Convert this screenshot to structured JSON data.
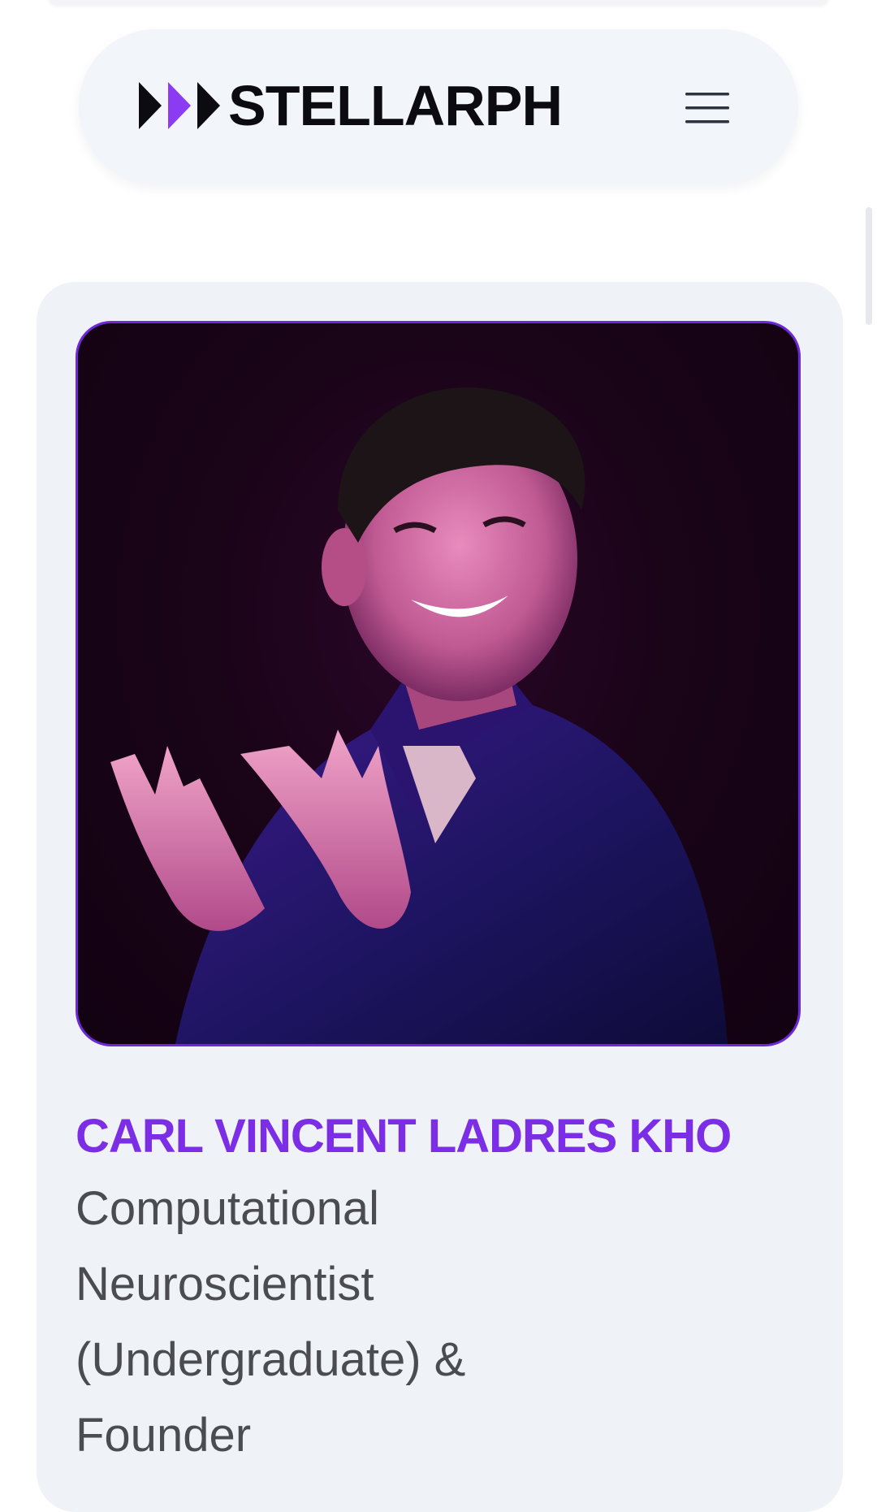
{
  "header": {
    "brand": "STELLARPH",
    "menu_icon": "hamburger-menu-icon",
    "logo_icon": "triple-play-arrows-icon"
  },
  "profile": {
    "name": "CARL VINCENT LADRES KHO",
    "role": "Computational Neuroscientist (Undergraduate) & Founder",
    "photo_alt": "Portrait photo"
  },
  "colors": {
    "accent": "#7c2ee6",
    "brand_dark": "#0b0b10",
    "card_bg": "#eff2f7",
    "photo_border": "#6d28d9"
  }
}
